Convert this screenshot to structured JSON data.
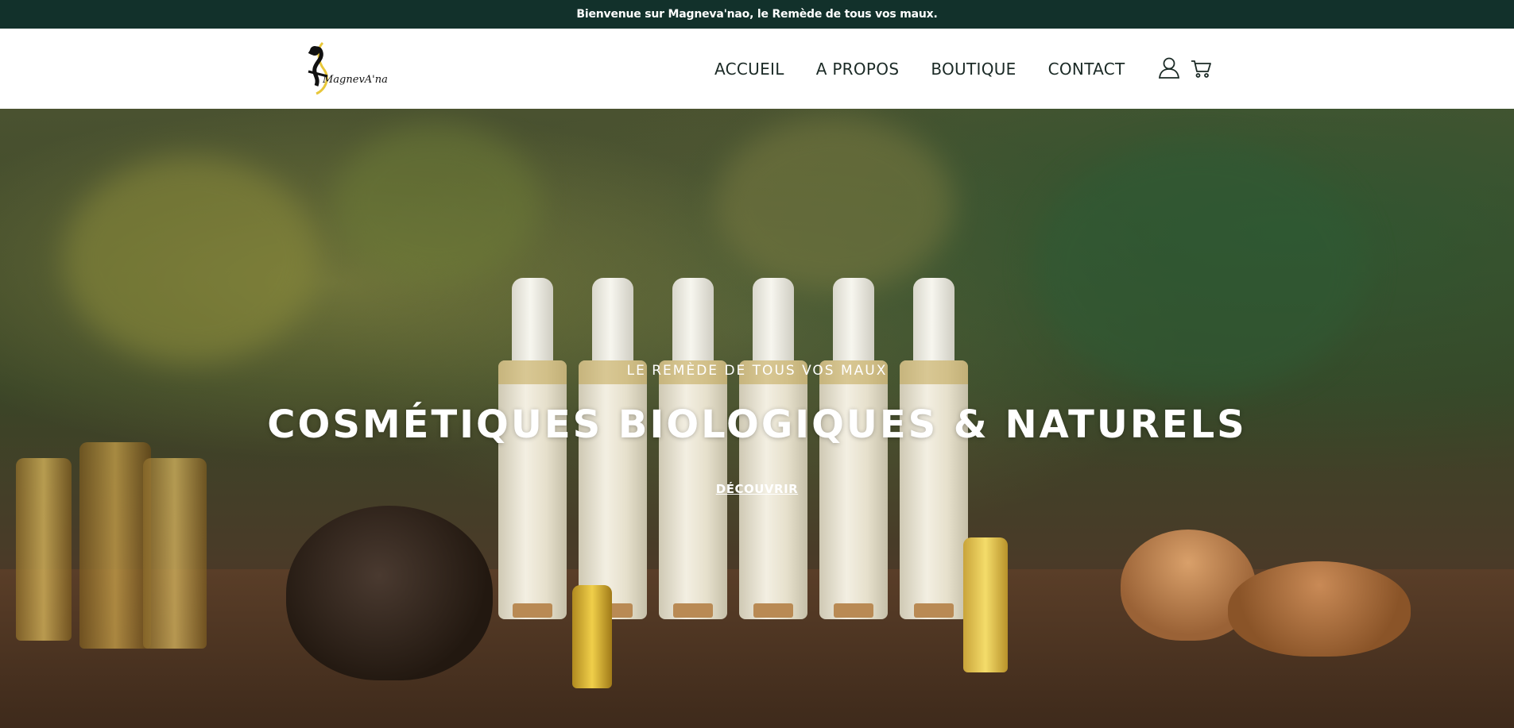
{
  "announcement": {
    "text": "Bienvenue sur Magneva'nao, le Remède de tous vos maux."
  },
  "header": {
    "logo_alt": "Magneva'nao",
    "logo_text": "MagnevA'nao",
    "nav": [
      {
        "label": "ACCUEIL"
      },
      {
        "label": "A PROPOS"
      },
      {
        "label": "BOUTIQUE"
      },
      {
        "label": "CONTACT"
      }
    ],
    "account_icon": "user-icon",
    "cart_icon": "cart-icon"
  },
  "hero": {
    "eyebrow": "LE REMÈDE DE TOUS VOS MAUX",
    "headline": "COSMÉTIQUES BIOLOGIQUES & NATURELS",
    "cta": "DÉCOUVRIR"
  },
  "colors": {
    "announcement_bg": "#12312b",
    "nav_text": "#1b2a26",
    "hero_text": "#ffffff"
  }
}
